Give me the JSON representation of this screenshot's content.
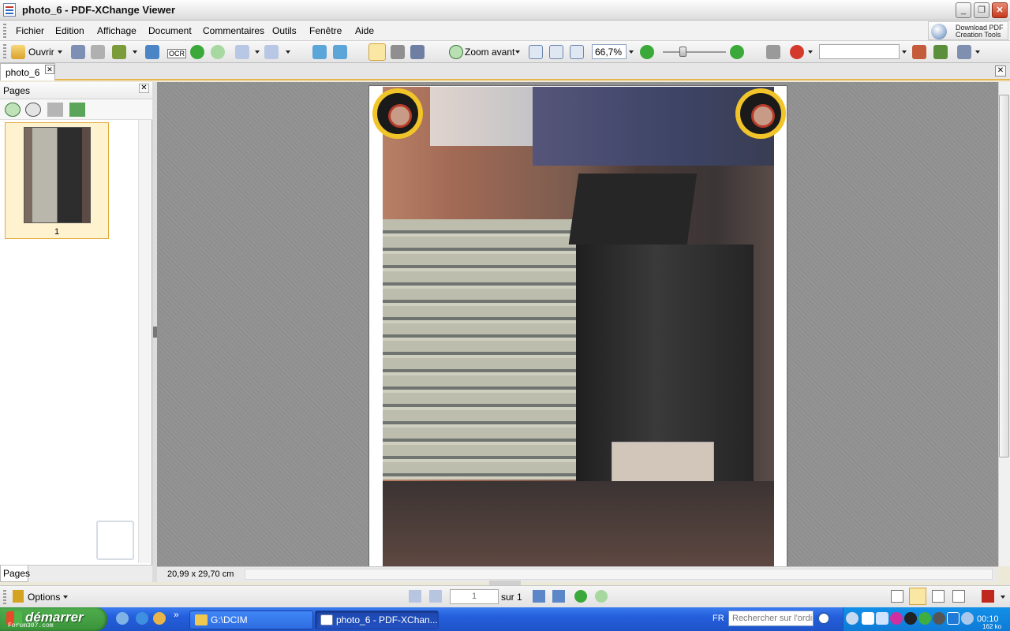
{
  "window": {
    "title": "photo_6 - PDF-XChange Viewer",
    "controls": {
      "minimize": "_",
      "restore": "❐",
      "close": "✕"
    }
  },
  "menubar": {
    "items": [
      "Fichier",
      "Edition",
      "Affichage",
      "Document",
      "Commentaires",
      "Outils",
      "Fenêtre",
      "Aide"
    ],
    "ad": {
      "line1": "Download PDF",
      "line2": "Creation Tools"
    }
  },
  "toolbar": {
    "open_label": "Ouvrir",
    "ocr_label": "OCR",
    "zoom_in_label": "Zoom avant",
    "zoom_value": "66,7%",
    "find_value": ""
  },
  "tabs": {
    "document_tab": "photo_6",
    "close_glyph": "✕"
  },
  "left_panel": {
    "title": "Pages",
    "close_glyph": "✕",
    "thumbnail_page_number": "1",
    "footer_tab": "Pages"
  },
  "status": {
    "page_size": "20,99 x 29,70 cm"
  },
  "bottombar": {
    "options_label": "Options",
    "page_current": "1",
    "page_of": "sur 1"
  },
  "taskbar": {
    "start_label": "démarrer",
    "watermark": "Forum307.com",
    "tasks": [
      {
        "label": "G:\\DCIM"
      },
      {
        "label": "photo_6 - PDF-XChan..."
      }
    ],
    "language": "FR",
    "search_placeholder": "Rechercher sur l'ordin",
    "clock": "00:10",
    "kb_rate": "162 ko"
  },
  "colors": {
    "accent_orange": "#e9b44a",
    "xp_blue": "#245edb",
    "start_green": "#3a9339",
    "seal_gold": "#f1c42a"
  },
  "icons": [
    "app-icon",
    "open-folder-icon",
    "save-icon",
    "print-icon",
    "scan-icon",
    "ocr-icon",
    "back-icon",
    "forward-icon",
    "undo-icon",
    "redo-icon",
    "rotate-icon",
    "hand-tool-icon",
    "snapshot-icon",
    "select-tool-icon",
    "zoom-in-icon",
    "actual-size-icon",
    "fit-page-icon",
    "fit-width-icon",
    "zoom-out-minus-icon",
    "zoom-in-plus-icon",
    "find-icon",
    "ask-icon",
    "options-flag-icon",
    "first-page-icon",
    "prev-page-icon",
    "next-page-icon",
    "last-page-icon",
    "history-back-icon",
    "history-forward-icon",
    "windows-logo-icon"
  ]
}
